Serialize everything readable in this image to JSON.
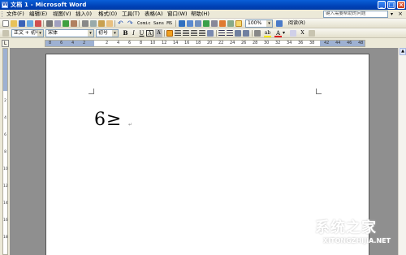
{
  "window": {
    "title": "文档 1 - Microsoft Word",
    "app_icon": "W",
    "minimize": "_",
    "maximize": "□",
    "close": "×"
  },
  "menubar": {
    "items": [
      "文件(F)",
      "编辑(E)",
      "视图(V)",
      "插入(I)",
      "格式(O)",
      "工具(T)",
      "表格(A)",
      "窗口(W)",
      "帮助(H)"
    ],
    "help_placeholder": "键入需要帮助的问题",
    "close_doc": "×"
  },
  "toolbar_standard": {
    "font_name_preview": "Comic Sans MS",
    "zoom": "100%",
    "read_label": "阅读(R)"
  },
  "toolbar_formatting": {
    "style": "正文 + 初号",
    "font": "宋体",
    "size": "初号",
    "bold": "B",
    "italic": "I",
    "underline": "U",
    "char_border": "A",
    "char_shading": "A",
    "highlight": "ab",
    "font_color": "A",
    "x_sub": "X"
  },
  "ruler": {
    "corner": "L",
    "labels": [
      "8",
      "6",
      "4",
      "2",
      "2",
      "4",
      "6",
      "8",
      "10",
      "12",
      "14",
      "16",
      "18",
      "20",
      "22",
      "24",
      "26",
      "28",
      "30",
      "32",
      "34",
      "36",
      "38",
      "42",
      "44",
      "46",
      "48"
    ]
  },
  "vruler": {
    "labels": [
      "2",
      "4",
      "6",
      "8",
      "10",
      "12",
      "14",
      "16",
      "18"
    ]
  },
  "document": {
    "text": "6≥",
    "paragraph_mark": "↵"
  },
  "watermark": {
    "brand": "系统之家",
    "url": "XITONGZHIJIA.NET"
  },
  "colors": {
    "titlebar": "#0043b8",
    "accent_orange": "#f0a020",
    "font_color_red": "#e02020",
    "highlight_yellow": "#f6e800"
  }
}
